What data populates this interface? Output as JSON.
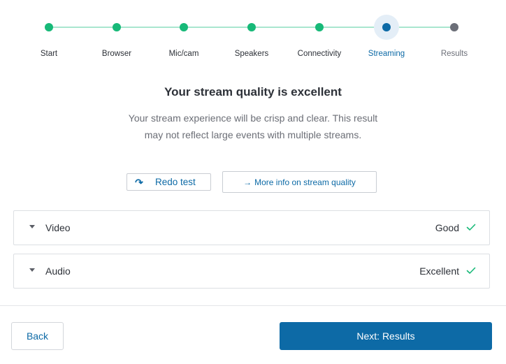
{
  "stepper": {
    "steps": [
      {
        "label": "Start",
        "state": "done"
      },
      {
        "label": "Browser",
        "state": "done"
      },
      {
        "label": "Mic/cam",
        "state": "done"
      },
      {
        "label": "Speakers",
        "state": "done"
      },
      {
        "label": "Connectivity",
        "state": "done"
      },
      {
        "label": "Streaming",
        "state": "current"
      },
      {
        "label": "Results",
        "state": "pending"
      }
    ]
  },
  "main": {
    "title": "Your stream quality is excellent",
    "description": "Your stream experience will be crisp and clear. This result may not reflect large events with multiple streams.",
    "redo_label": "Redo test",
    "info_label": "More info on stream quality"
  },
  "results": [
    {
      "label": "Video",
      "status": "Good"
    },
    {
      "label": "Audio",
      "status": "Excellent"
    }
  ],
  "footer": {
    "back_label": "Back",
    "next_label": "Next: Results"
  },
  "colors": {
    "accent": "#0d6aa6",
    "success": "#17b978"
  }
}
